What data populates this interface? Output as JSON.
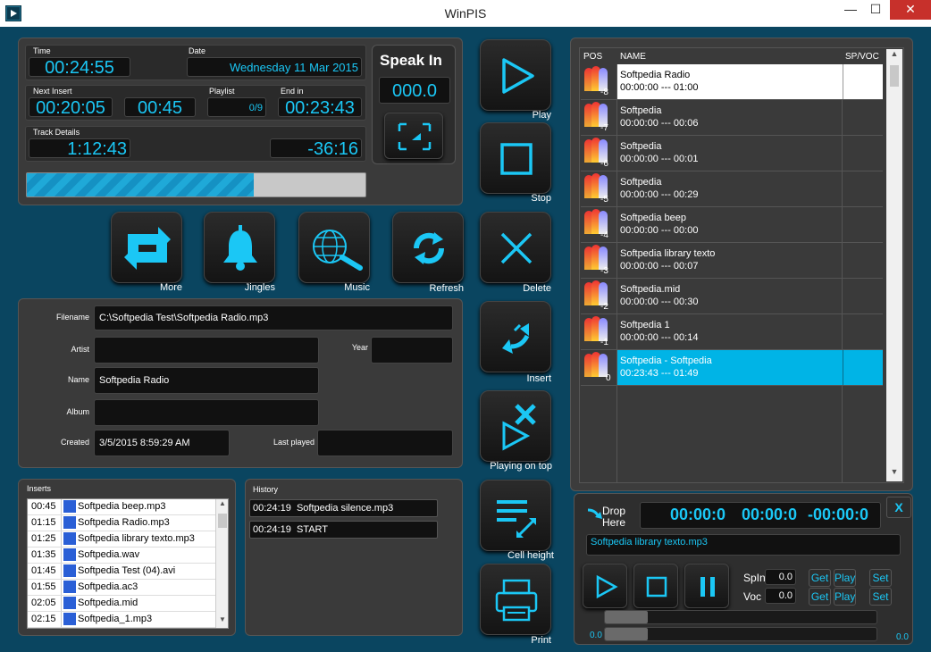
{
  "window": {
    "title": "WinPIS",
    "minimize": "—",
    "maximize": "☐",
    "close": "✕"
  },
  "time_panel": {
    "time_label": "Time",
    "time_value": "00:24:55",
    "date_label": "Date",
    "date_value": "Wednesday 11 Mar 2015",
    "next_insert_label": "Next Insert",
    "next_insert_value": "00:20:05",
    "next_insert_extra": "00:45",
    "playlist_label": "Playlist",
    "playlist_value": "0/9",
    "end_in_label": "End in",
    "end_in_value": "00:23:43",
    "track_details_label": "Track Details",
    "track_time": "1:12:43",
    "track_remaining": "-36:16",
    "progress": 0.67
  },
  "speak_in": {
    "label": "Speak In",
    "value": "000.0"
  },
  "side_buttons": {
    "play": "Play",
    "stop": "Stop",
    "delete": "Delete",
    "insert": "Insert",
    "playing_on_top": "Playing on top",
    "cell_height": "Cell height",
    "print": "Print"
  },
  "tool_buttons": {
    "more": "More",
    "jingles": "Jingles",
    "music": "Music",
    "refresh": "Refresh"
  },
  "details": {
    "filename_label": "Filename",
    "filename": "C:\\Softpedia Test\\Softpedia Radio.mp3",
    "artist_label": "Artist",
    "artist": "",
    "year_label": "Year",
    "year": "",
    "name_label": "Name",
    "name": "Softpedia Radio",
    "album_label": "Album",
    "album": "",
    "created_label": "Created",
    "created": "3/5/2015 8:59:29 AM",
    "last_played_label": "Last played",
    "last_played": ""
  },
  "inserts": {
    "label": "Inserts",
    "rows": [
      {
        "time": "00:45",
        "file": "Softpedia beep.mp3"
      },
      {
        "time": "01:15",
        "file": "Softpedia Radio.mp3"
      },
      {
        "time": "01:25",
        "file": "Softpedia library texto.mp3"
      },
      {
        "time": "01:35",
        "file": "Softpedia.wav"
      },
      {
        "time": "01:45",
        "file": "Softpedia Test (04).avi"
      },
      {
        "time": "01:55",
        "file": "Softpedia.ac3"
      },
      {
        "time": "02:05",
        "file": "Softpedia.mid"
      },
      {
        "time": "02:15",
        "file": "Softpedia_1.mp3"
      }
    ]
  },
  "history": {
    "label": "History",
    "rows": [
      {
        "time": "00:24:19",
        "text": "Softpedia silence.mp3"
      },
      {
        "time": "00:24:19",
        "text": "START"
      }
    ]
  },
  "playlist": {
    "col_pos": "POS",
    "col_name": "NAME",
    "col_spvoc": "SP/VOC",
    "rows": [
      {
        "pos": "-8",
        "name": "Softpedia Radio",
        "time": "00:00:00 --- 01:00"
      },
      {
        "pos": "-7",
        "name": "Softpedia",
        "time": "00:00:00 --- 00:06"
      },
      {
        "pos": "-6",
        "name": "Softpedia",
        "time": "00:00:00 --- 00:01"
      },
      {
        "pos": "-5",
        "name": "Softpedia",
        "time": "00:00:00 --- 00:29"
      },
      {
        "pos": "-4",
        "name": "Softpedia beep",
        "time": "00:00:00 --- 00:00"
      },
      {
        "pos": "-3",
        "name": "Softpedia library texto",
        "time": "00:00:00 --- 00:07"
      },
      {
        "pos": "-2",
        "name": "Softpedia.mid",
        "time": "00:00:00 --- 00:30"
      },
      {
        "pos": "-1",
        "name": "Softpedia 1",
        "time": "00:00:00 --- 00:14"
      },
      {
        "pos": "0",
        "name": "Softpedia - Softpedia",
        "time": "00:23:43 --- 01:49"
      }
    ]
  },
  "player": {
    "drop_here": "Drop Here",
    "close": "X",
    "time1": "00:00:0",
    "time2": "00:00:0",
    "time3": "-00:00:0",
    "file": "Softpedia library texto.mp3",
    "spin_label": "SpIn",
    "spin_value": "0.0",
    "voc_label": "Voc",
    "voc_value": "0.0",
    "get": "Get",
    "play": "Play",
    "set": "Set",
    "slider_left": "0.0",
    "slider_right": "0.0"
  },
  "colors": {
    "accent": "#1bc7f5",
    "background": "#0a4560",
    "panel": "#3a3a3a",
    "selected_row": "#00b4e6"
  }
}
